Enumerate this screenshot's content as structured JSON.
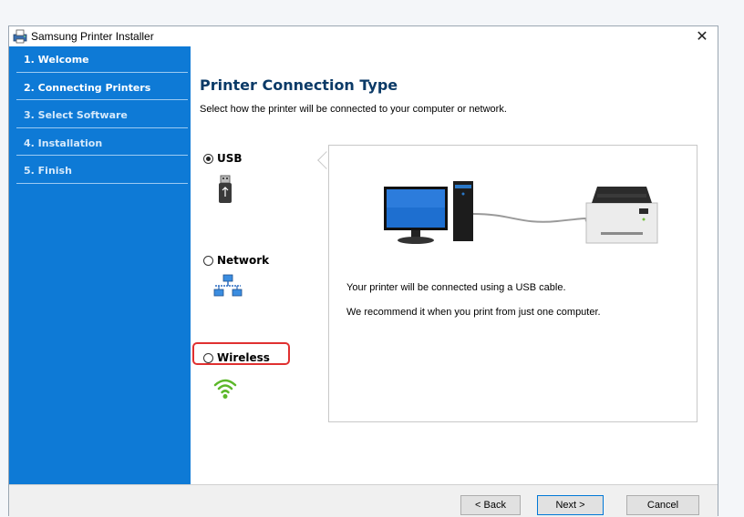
{
  "window": {
    "title": "Samsung Printer Installer"
  },
  "sidebar": {
    "steps": [
      {
        "label": "1. Welcome"
      },
      {
        "label": "2. Connecting Printers"
      },
      {
        "label": "3. Select Software"
      },
      {
        "label": "4. Installation"
      },
      {
        "label": "5. Finish"
      }
    ],
    "active_index": 1
  },
  "main": {
    "heading": "Printer Connection Type",
    "subheading": "Select how the printer will be connected to your computer or network.",
    "options": [
      {
        "label": "USB",
        "checked": true,
        "icon": "usb-icon"
      },
      {
        "label": "Network",
        "checked": false,
        "icon": "network-icon"
      },
      {
        "label": "Wireless",
        "checked": false,
        "icon": "wireless-icon"
      }
    ],
    "preview": {
      "line1": "Your printer will be connected using a USB cable.",
      "line2": "We recommend it when you print from just one computer."
    }
  },
  "footer": {
    "back_label": "< Back",
    "next_label": "Next >",
    "cancel_label": "Cancel"
  },
  "colors": {
    "sidebar": "#0e7ad6",
    "heading": "#0b3a67",
    "highlight": "#e03030",
    "wireless": "#5cb82a"
  }
}
